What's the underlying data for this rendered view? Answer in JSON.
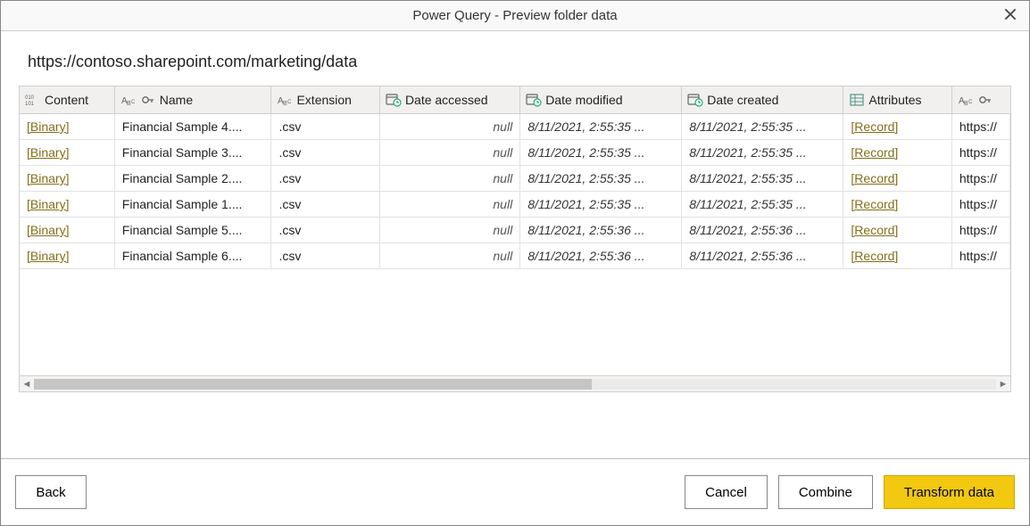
{
  "window": {
    "title": "Power Query - Preview folder data"
  },
  "url": "https://contoso.sharepoint.com/marketing/data",
  "columns": {
    "content": "Content",
    "name": "Name",
    "extension": "Extension",
    "date_accessed": "Date accessed",
    "date_modified": "Date modified",
    "date_created": "Date created",
    "attributes": "Attributes",
    "folder_path": ""
  },
  "cell_labels": {
    "binary": "[Binary]",
    "record": "[Record]",
    "null": "null"
  },
  "rows": [
    {
      "name": "Financial Sample 4....",
      "ext": ".csv",
      "accessed": "null",
      "modified": "8/11/2021, 2:55:35 ...",
      "created": "8/11/2021, 2:55:35 ...",
      "path": "https://"
    },
    {
      "name": "Financial Sample 3....",
      "ext": ".csv",
      "accessed": "null",
      "modified": "8/11/2021, 2:55:35 ...",
      "created": "8/11/2021, 2:55:35 ...",
      "path": "https://"
    },
    {
      "name": "Financial Sample 2....",
      "ext": ".csv",
      "accessed": "null",
      "modified": "8/11/2021, 2:55:35 ...",
      "created": "8/11/2021, 2:55:35 ...",
      "path": "https://"
    },
    {
      "name": "Financial Sample 1....",
      "ext": ".csv",
      "accessed": "null",
      "modified": "8/11/2021, 2:55:35 ...",
      "created": "8/11/2021, 2:55:35 ...",
      "path": "https://"
    },
    {
      "name": "Financial Sample 5....",
      "ext": ".csv",
      "accessed": "null",
      "modified": "8/11/2021, 2:55:36 ...",
      "created": "8/11/2021, 2:55:36 ...",
      "path": "https://"
    },
    {
      "name": "Financial Sample 6....",
      "ext": ".csv",
      "accessed": "null",
      "modified": "8/11/2021, 2:55:36 ...",
      "created": "8/11/2021, 2:55:36 ...",
      "path": "https://"
    }
  ],
  "buttons": {
    "back": "Back",
    "cancel": "Cancel",
    "combine": "Combine",
    "transform": "Transform data"
  }
}
